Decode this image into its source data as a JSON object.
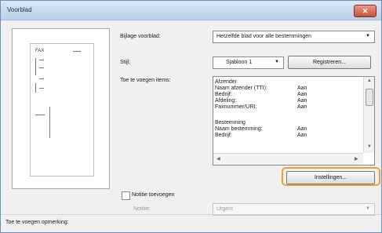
{
  "dialog": {
    "title": "Voorblad",
    "close_glyph": "✕"
  },
  "preview": {
    "fax_label": "FAX"
  },
  "form": {
    "attach_label": "Bijlage voorblad:",
    "attach_value": "Hetzelfde blad voor alle bestemmingen",
    "style_label": "Stijl:",
    "style_value": "Sjabloon 1",
    "register_button": "Registreren...",
    "items_label": "Toe te voegen items:",
    "settings_button": "Instellingen...",
    "notice_checkbox_label": "Notitie toevoegen",
    "notice_checked": false,
    "notice_label": "Notitie:",
    "notice_value": "Urgent",
    "add_comment_label": "Toe te voegen opmerking:"
  },
  "items": {
    "sender_header": "Afzender",
    "sender_rows": [
      {
        "key": "Naam afzender (TTI):",
        "value": "Aan"
      },
      {
        "key": "Bedrijf:",
        "value": "Aan"
      },
      {
        "key": "Afdeling:",
        "value": "Aan"
      },
      {
        "key": "Faxnummer/URI:",
        "value": "Aan"
      }
    ],
    "dest_header": "Bestemming",
    "dest_rows": [
      {
        "key": "Naam bestemming:",
        "value": "Aan"
      },
      {
        "key": "Bedrijf:",
        "value": "Aan"
      }
    ]
  },
  "icons": {
    "dropdown": "chevron-down-icon",
    "close": "close-icon"
  },
  "colors": {
    "focus_ring": "#f0a030",
    "titlebar": "#b9d0ec",
    "close_button": "#c8503a"
  }
}
